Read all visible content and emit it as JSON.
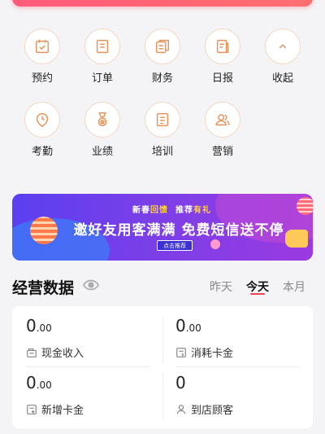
{
  "top_menu": {
    "row1": [
      {
        "label": "预约",
        "icon": "calendar-check-icon"
      },
      {
        "label": "订单",
        "icon": "order-doc-icon"
      },
      {
        "label": "财务",
        "icon": "finance-icon"
      },
      {
        "label": "日报",
        "icon": "daily-report-icon"
      },
      {
        "label": "收起",
        "icon": "chevron-up-icon"
      }
    ],
    "row2": [
      {
        "label": "考勤",
        "icon": "clock-pin-icon"
      },
      {
        "label": "业绩",
        "icon": "medal-icon"
      },
      {
        "label": "培训",
        "icon": "training-doc-icon"
      },
      {
        "label": "营销",
        "icon": "people-icon"
      }
    ]
  },
  "banner": {
    "subtitle_a": "新春",
    "subtitle_b": "回馈",
    "subtitle_c": "推荐",
    "subtitle_d": "有礼",
    "headline": "邀好友用客满满 免费短信送不停",
    "cta": "点击推荐"
  },
  "business_data": {
    "title": "经营数据",
    "tabs": [
      "昨天",
      "今天",
      "本月"
    ],
    "active_tab": "今天",
    "items": [
      {
        "int": "0",
        "dec": ".00",
        "label": "现金收入",
        "icon": "cash-register-icon"
      },
      {
        "int": "0",
        "dec": ".00",
        "label": "消耗卡金",
        "icon": "card-consume-icon"
      },
      {
        "int": "0",
        "dec": ".00",
        "label": "新增卡金",
        "icon": "card-add-icon"
      },
      {
        "int": "0",
        "dec": "",
        "label": "到店顾客",
        "icon": "customer-icon"
      }
    ]
  },
  "colors": {
    "accent": "#e8935a",
    "tab_underline": "#f04058",
    "top_bar": "#ff5a7a"
  }
}
